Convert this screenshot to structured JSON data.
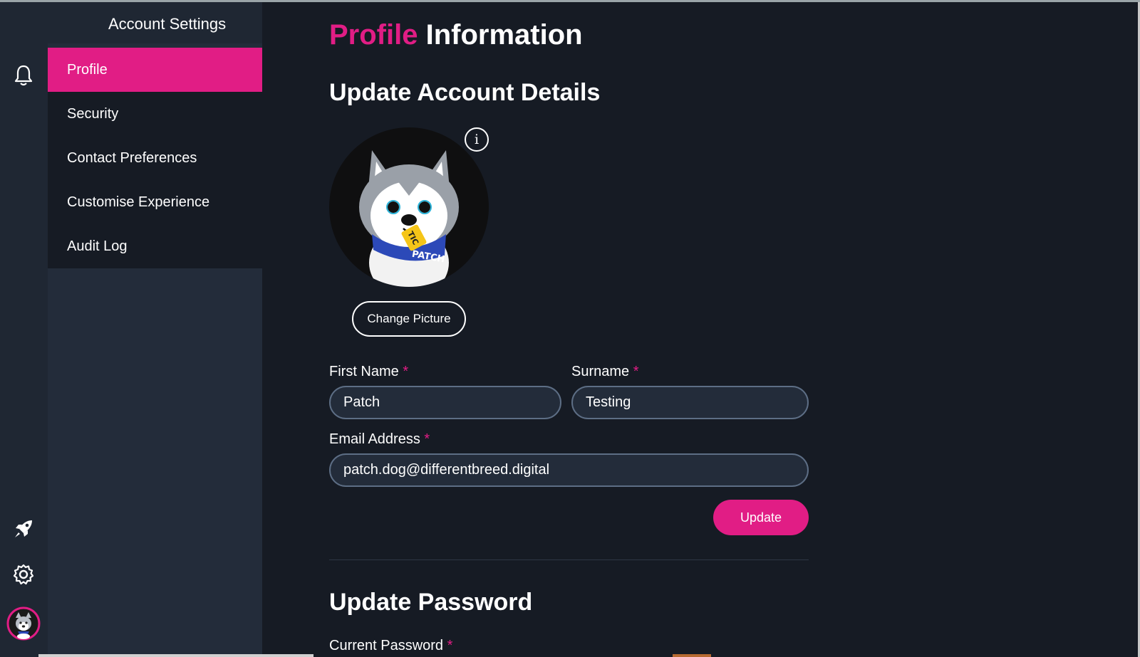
{
  "panel": {
    "title": "Account Settings",
    "items": [
      {
        "label": "Profile",
        "active": true
      },
      {
        "label": "Security",
        "active": false
      },
      {
        "label": "Contact Preferences",
        "active": false
      },
      {
        "label": "Customise Experience",
        "active": false
      },
      {
        "label": "Audit Log",
        "active": false
      }
    ]
  },
  "rail": {
    "icons": [
      "brand-logo-icon",
      "bell-icon",
      "rocket-icon",
      "gear-icon",
      "user-avatar"
    ]
  },
  "main": {
    "title_accent": "Profile",
    "title_rest": " Information",
    "account_section": "Update Account Details",
    "change_picture_label": "Change Picture",
    "info_glyph": "i",
    "avatar_tag_text": "TIC",
    "avatar_bandana_text": "PATCH",
    "first_name_label": "First Name",
    "first_name_value": "Patch",
    "surname_label": "Surname",
    "surname_value": "Testing",
    "email_label": "Email Address",
    "email_value": "patch.dog@differentbreed.digital",
    "required_marker": "*",
    "update_label": "Update",
    "password_section": "Update Password",
    "current_password_label": "Current Password"
  },
  "colors": {
    "accent": "#e11d85",
    "background": "#161b24",
    "panel": "#232c3a",
    "rail": "#1f2733",
    "field_border": "#5d6e85"
  }
}
